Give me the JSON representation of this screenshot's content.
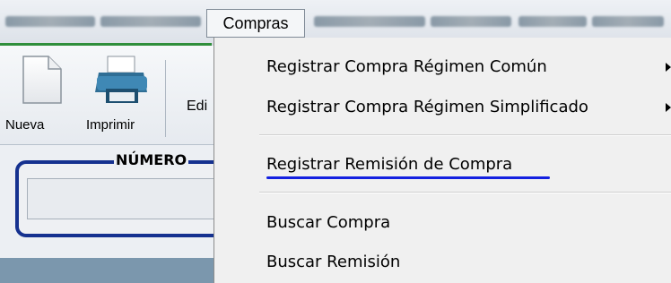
{
  "menubar": {
    "active_menu": "Compras"
  },
  "toolbar": {
    "new_label": "Nueva",
    "print_label": "Imprimir",
    "edit_label_partial": "Edi"
  },
  "form": {
    "numero_label": "NÚMERO"
  },
  "dropdown": {
    "items": [
      {
        "label": "Registrar Compra Régimen Común",
        "has_submenu": true
      },
      {
        "label": "Registrar Compra Régimen Simplificado",
        "has_submenu": true
      },
      {
        "label": "Registrar Remisión de Compra",
        "has_submenu": false
      },
      {
        "label": "Buscar Compra",
        "has_submenu": false
      },
      {
        "label": "Buscar Remisión",
        "has_submenu": false
      }
    ]
  },
  "colors": {
    "highlight_underline": "#1320e0",
    "form_border": "#15318f",
    "menu_rule": "#2f8f3c"
  }
}
